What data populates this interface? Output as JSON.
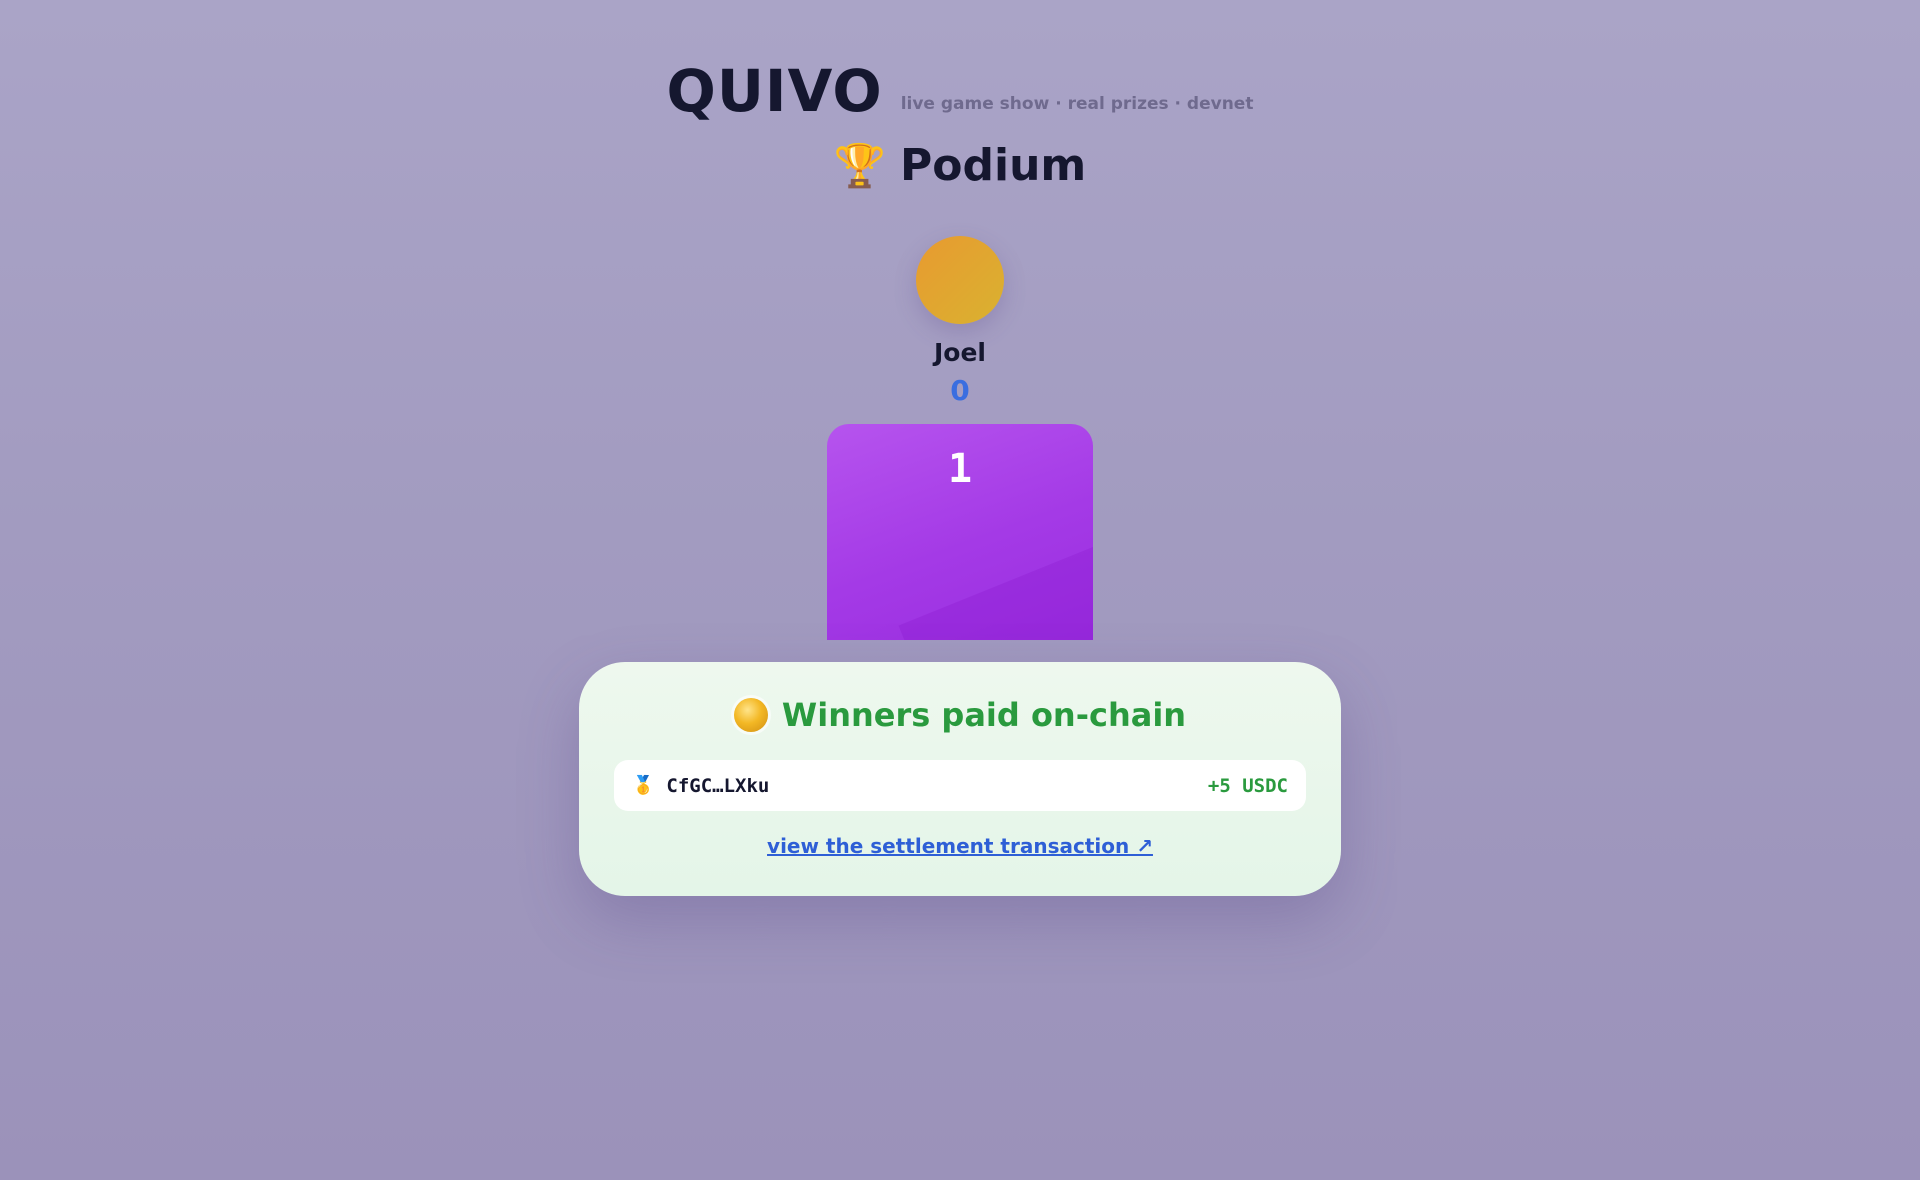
{
  "header": {
    "logo": "QUIVO",
    "tagline": "live game show · real prizes · devnet"
  },
  "podium": {
    "title_icon": "🏆",
    "title": "Podium",
    "player": {
      "name": "Joel",
      "score": "0",
      "rank": "1"
    }
  },
  "winners": {
    "title": "Winners paid on-chain",
    "payouts": [
      {
        "medal": "🥇",
        "wallet": "CfGC…LXku",
        "amount": "+5 USDC"
      }
    ],
    "settlement_link": "view the settlement transaction ↗"
  },
  "colors": {
    "accent_green": "#2a9a3e",
    "score_blue": "#3a6ee0",
    "podium_purple": "#a43ae6",
    "link_blue": "#2e5fd6"
  }
}
